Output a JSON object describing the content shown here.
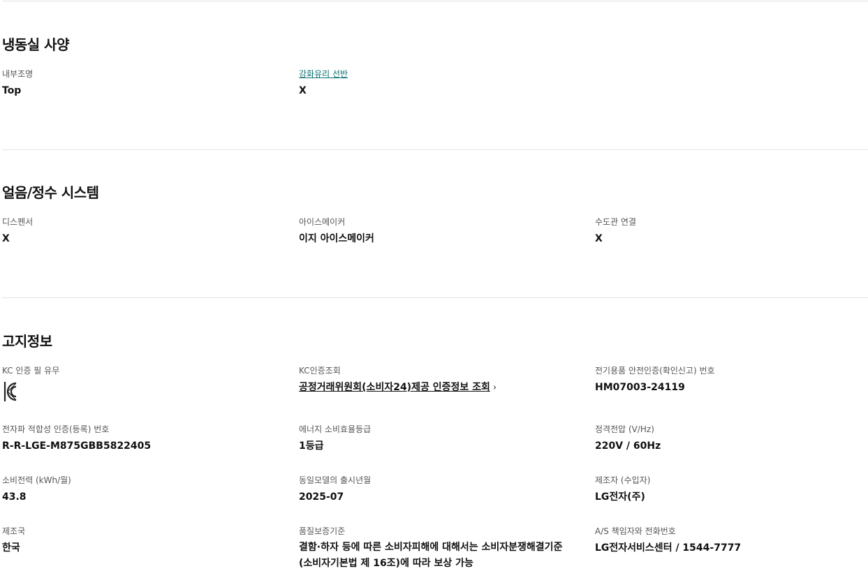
{
  "freezer": {
    "title": "냉동실 사양",
    "specs": [
      {
        "label": "내부조명",
        "value": "Top"
      },
      {
        "label": "강화유리 선반",
        "value": "X"
      }
    ]
  },
  "ice_water": {
    "title": "얼음/정수 시스템",
    "specs": [
      {
        "label": "디스펜서",
        "value": "X"
      },
      {
        "label": "아이스메이커",
        "value": "이지 아이스메이커"
      },
      {
        "label": "수도관 연결",
        "value": "X"
      }
    ]
  },
  "notice": {
    "title": "고지정보",
    "kc_required": {
      "label": "KC 인증 필 유무",
      "icon": "kc-certification-icon"
    },
    "kc_lookup": {
      "label": "KC인증조회",
      "link_text": "공정거래위원회(소비자24)제공 인증정보 조회",
      "chevron": "›"
    },
    "safety_cert": {
      "label": "전기용품 안전인증(확인신고) 번호",
      "value": "HM07003-24119"
    },
    "emc_cert": {
      "label": "전자파 적합성 인증(등록) 번호",
      "value": "R-R-LGE-M875GBB5822405"
    },
    "energy_grade": {
      "label": "에너지 소비효율등급",
      "value": "1등급"
    },
    "rated_voltage": {
      "label": "정격전압 (V/Hz)",
      "value": "220V / 60Hz"
    },
    "power_consumption": {
      "label": "소비전력 (kWh/월)",
      "value": "43.8"
    },
    "release_date": {
      "label": "동일모델의 출시년월",
      "value": "2025-07"
    },
    "manufacturer": {
      "label": "제조자 (수입자)",
      "value": "LG전자(주)"
    },
    "country": {
      "label": "제조국",
      "value": "한국"
    },
    "warranty": {
      "label": "품질보증기준",
      "value": "결함·하자 등에 따른 소비자피해에 대해서는 소비자분쟁해결기준 (소비자기본법 제 16조)에 따라 보상 가능"
    },
    "as_contact": {
      "label": "A/S 책임자와 전화번호",
      "value": "LG전자서비스센터 / 1544-7777"
    }
  }
}
